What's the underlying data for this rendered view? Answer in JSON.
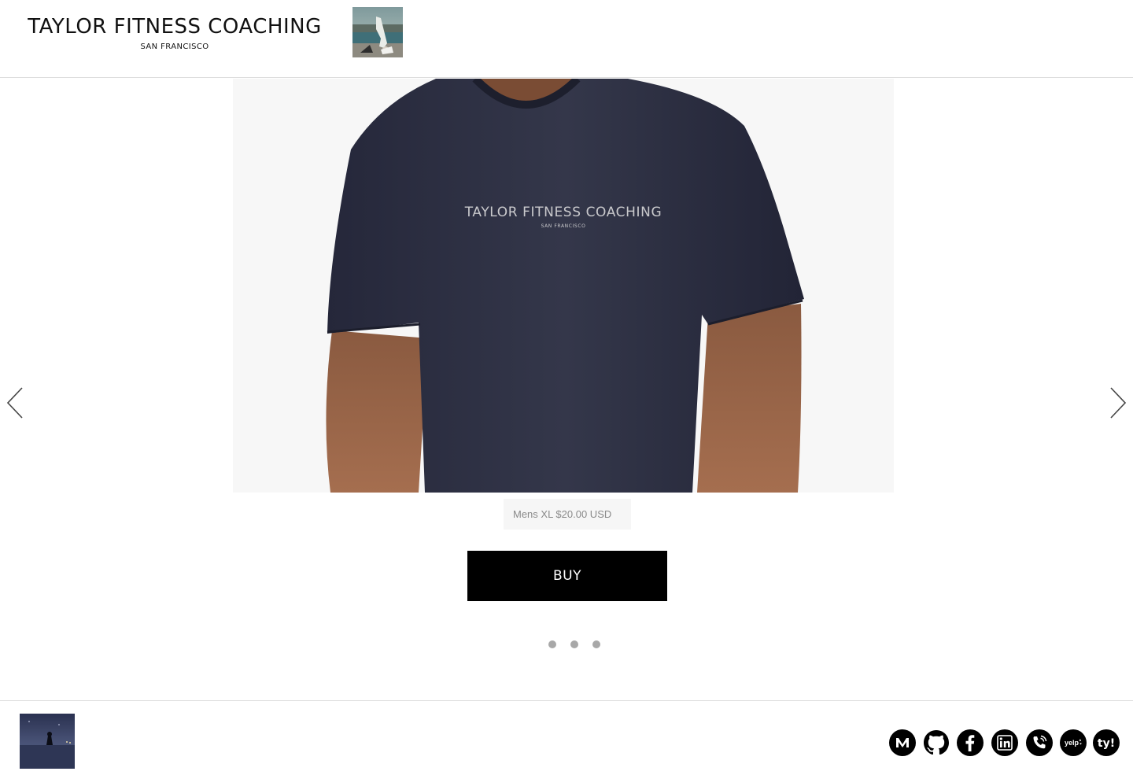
{
  "header": {
    "title": "TAYLOR FITNESS COACHING",
    "subtitle": "SAN FRANCISCO"
  },
  "product": {
    "shirt_print_title": "TAYLOR FITNESS COACHING",
    "shirt_print_subtitle": "SAN FRANCISCO",
    "variant_label": "Mens XL $20.00 USD",
    "buy_label": "BUY"
  },
  "slider": {
    "prev_icon": "chevron-left-icon",
    "next_icon": "chevron-right-icon",
    "dot_count": 3
  },
  "footer": {
    "social_icons": [
      "medium-icon",
      "github-icon",
      "facebook-icon",
      "linkedin-icon",
      "phone-icon",
      "yelp-icon",
      "ty-icon"
    ],
    "yelp_text": "yelp",
    "ty_text": "ty!"
  },
  "colors": {
    "accent": "#000000",
    "shirt": "#2c2e3d",
    "dot": "#a8a8a8",
    "variant_bg": "#f6f6f6"
  }
}
